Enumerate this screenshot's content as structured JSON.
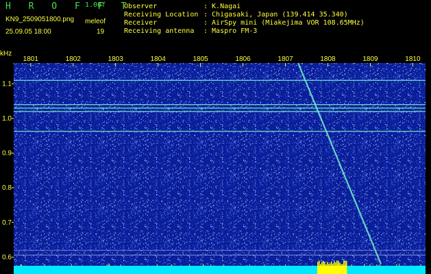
{
  "header": {
    "app_name": "H R O F F T",
    "version": "1.00f",
    "filename": "KN9_2509051800.png",
    "program": "meleof",
    "timestamp": "25.09.05 18:00",
    "frame_number": "19"
  },
  "metadata": [
    {
      "key": "Observer",
      "value": ": K.Nagai"
    },
    {
      "key": "Receiving Location",
      "value": ": Chigasaki, Japan (139.414 35.340)"
    },
    {
      "key": "Receiver",
      "value": ": AirSpy mini (Miakejima VOR 108.65MHz)"
    },
    {
      "key": "Receiving antenna",
      "value": ": Maspro FM-3"
    }
  ],
  "colors": {
    "background": "#000000",
    "plot_noise_base": "#0a1e9a",
    "header_text": "#ffff40",
    "title_green": "#4ade4a",
    "signal": "#6ee8c8",
    "baseline": "#00e8ff",
    "burst": "#ffff00"
  },
  "chart_data": {
    "type": "heatmap",
    "title": "",
    "ylabel": "kHz",
    "xlabel": "",
    "x_ticks": [
      "1801",
      "1802",
      "1803",
      "1804",
      "1805",
      "1806",
      "1807",
      "1808",
      "1809",
      "1810"
    ],
    "y_ticks": [
      "1.1",
      "1.0",
      "0.9",
      "0.8",
      "0.7",
      "0.6"
    ],
    "x_range": [
      1800.6,
      1810.3
    ],
    "ylim": [
      0.575,
      1.16
    ],
    "horizontal_lines_khz": [
      1.11,
      1.04,
      1.03,
      1.02,
      0.963,
      0.62,
      0.606
    ],
    "meteor_trail": {
      "start": {
        "x": 1807.3,
        "y": 1.16
      },
      "end": {
        "x": 1809.25,
        "y": 0.58
      }
    },
    "burst_range": [
      1807.75,
      1808.45
    ]
  }
}
